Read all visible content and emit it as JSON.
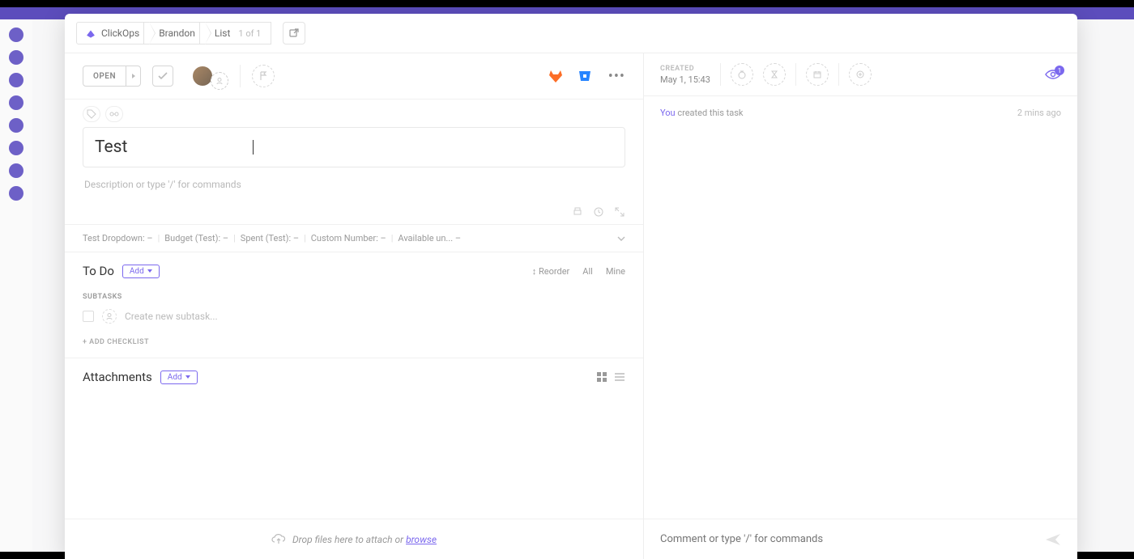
{
  "breadcrumb": {
    "workspace": "ClickOps",
    "space": "Brandon",
    "list": "List",
    "position": "1 of 1"
  },
  "task": {
    "status": "OPEN",
    "title": "Test",
    "description_placeholder": "Description or type '/' for commands"
  },
  "custom_fields": [
    {
      "label": "Test Dropdown:",
      "value": "–"
    },
    {
      "label": "Budget (Test):",
      "value": "–"
    },
    {
      "label": "Spent (Test):",
      "value": "–"
    },
    {
      "label": "Custom Number:",
      "value": "–"
    },
    {
      "label": "Available un...",
      "value": "–"
    }
  ],
  "todo": {
    "title": "To Do",
    "add_label": "Add",
    "reorder": "Reorder",
    "all": "All",
    "mine": "Mine",
    "subtasks_label": "SUBTASKS",
    "new_subtask_placeholder": "Create new subtask...",
    "add_checklist": "+ ADD CHECKLIST"
  },
  "attachments": {
    "title": "Attachments",
    "add_label": "Add"
  },
  "dropzone": {
    "text": "Drop files here to attach or ",
    "link": "browse"
  },
  "meta": {
    "created_label": "CREATED",
    "created_value": "May 1, 15:43",
    "watchers": "1"
  },
  "activity": {
    "you": "You",
    "text": " created this task",
    "time": "2 mins ago"
  },
  "comment": {
    "placeholder": "Comment or type '/' for commands"
  }
}
